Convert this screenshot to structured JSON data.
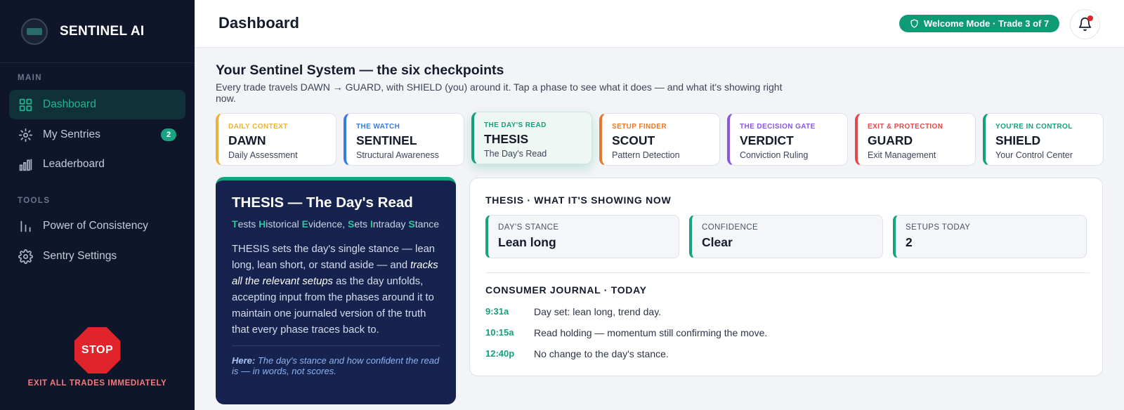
{
  "sidebar": {
    "brand": "SENTINEL AI",
    "section_main": "MAIN",
    "section_tools": "TOOLS",
    "items": [
      {
        "label": "Dashboard",
        "icon": "grid-icon",
        "active": true
      },
      {
        "label": "My Sentries",
        "icon": "sun-gear-icon",
        "badge": "2"
      },
      {
        "label": "Leaderboard",
        "icon": "bar-signal-icon"
      },
      {
        "label": "Power of Consistency",
        "icon": "bars-icon"
      },
      {
        "label": "Sentry Settings",
        "icon": "gear-icon"
      }
    ],
    "stop_label": "STOP",
    "stop_caption": "EXIT ALL TRADES IMMEDIATELY"
  },
  "header": {
    "title": "Dashboard",
    "mode_pill": "Welcome Mode · Trade 3 of 7"
  },
  "intro": {
    "title": "Your Sentinel System — the six checkpoints",
    "subtitle": "Every trade travels DAWN → GUARD, with SHIELD (you) around it. Tap a phase to see what it does — and what it's showing right now."
  },
  "phases": [
    {
      "kicker": "DAILY CONTEXT",
      "name": "DAWN",
      "desc": "Daily Assessment",
      "color": "#e8b33a"
    },
    {
      "kicker": "THE WATCH",
      "name": "SENTINEL",
      "desc": "Structural Awareness",
      "color": "#3a7be0"
    },
    {
      "kicker": "THE DAY'S READ",
      "name": "THESIS",
      "desc": "The Day's Read",
      "color": "#14a07b",
      "active": true
    },
    {
      "kicker": "SETUP FINDER",
      "name": "SCOUT",
      "desc": "Pattern Detection",
      "color": "#e5782a"
    },
    {
      "kicker": "THE DECISION GATE",
      "name": "VERDICT",
      "desc": "Conviction Ruling",
      "color": "#8a55e0"
    },
    {
      "kicker": "EXIT & PROTECTION",
      "name": "GUARD",
      "desc": "Exit Management",
      "color": "#e04a4a"
    },
    {
      "kicker": "YOU'RE IN CONTROL",
      "name": "SHIELD",
      "desc": "Your Control Center",
      "color": "#14a07b"
    }
  ],
  "thesis": {
    "title": "THESIS — The Day's Read",
    "acronym": [
      {
        "letter": "T",
        "rest": "ests "
      },
      {
        "letter": "H",
        "rest": "istorical "
      },
      {
        "letter": "E",
        "rest": "vidence, "
      },
      {
        "letter": "S",
        "rest": "ets "
      },
      {
        "letter": "I",
        "rest": "ntraday "
      },
      {
        "letter": "S",
        "rest": "tance"
      }
    ],
    "body_1": "THESIS sets the day's single stance — lean long, lean short, or stand aside — and ",
    "body_em": "tracks all the relevant setups",
    "body_2": " as the day unfolds, accepting input from the phases around it to maintain one journaled version of the truth that every phase traces back to.",
    "here_label": "Here:",
    "here_text": " The day's stance and how confident the read is — in words, not scores."
  },
  "panel": {
    "title": "THESIS · WHAT IT'S SHOWING NOW",
    "stats": [
      {
        "label": "DAY'S STANCE",
        "value": "Lean long"
      },
      {
        "label": "CONFIDENCE",
        "value": "Clear"
      },
      {
        "label": "SETUPS TODAY",
        "value": "2"
      }
    ],
    "journal_title": "CONSUMER JOURNAL · TODAY",
    "journal": [
      {
        "time": "9:31a",
        "text": "Day set: lean long, trend day."
      },
      {
        "time": "10:15a",
        "text": "Read holding — momentum still confirming the move."
      },
      {
        "time": "12:40p",
        "text": "No change to the day's stance."
      }
    ]
  }
}
